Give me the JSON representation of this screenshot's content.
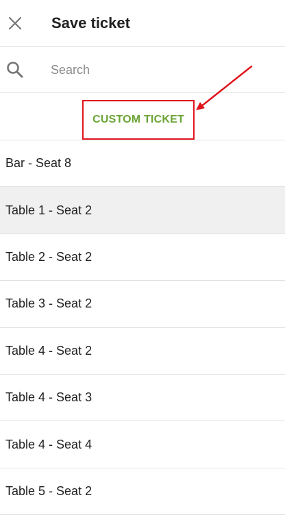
{
  "header": {
    "title": "Save ticket",
    "close_icon": "close-icon"
  },
  "search": {
    "icon": "search-icon",
    "placeholder": "Search",
    "value": ""
  },
  "custom_ticket": {
    "label": "CUSTOM TICKET",
    "color": "#6ba335",
    "highlight_color": "#e0141d"
  },
  "tickets": [
    {
      "label": "Bar - Seat 8",
      "selected": false
    },
    {
      "label": "Table 1 - Seat 2",
      "selected": true
    },
    {
      "label": "Table 2 - Seat 2",
      "selected": false
    },
    {
      "label": "Table 3 - Seat 2",
      "selected": false
    },
    {
      "label": "Table 4 - Seat 2",
      "selected": false
    },
    {
      "label": "Table 4 - Seat 3",
      "selected": false
    },
    {
      "label": "Table 4 - Seat 4",
      "selected": false
    },
    {
      "label": "Table 5 - Seat 2",
      "selected": false
    }
  ]
}
